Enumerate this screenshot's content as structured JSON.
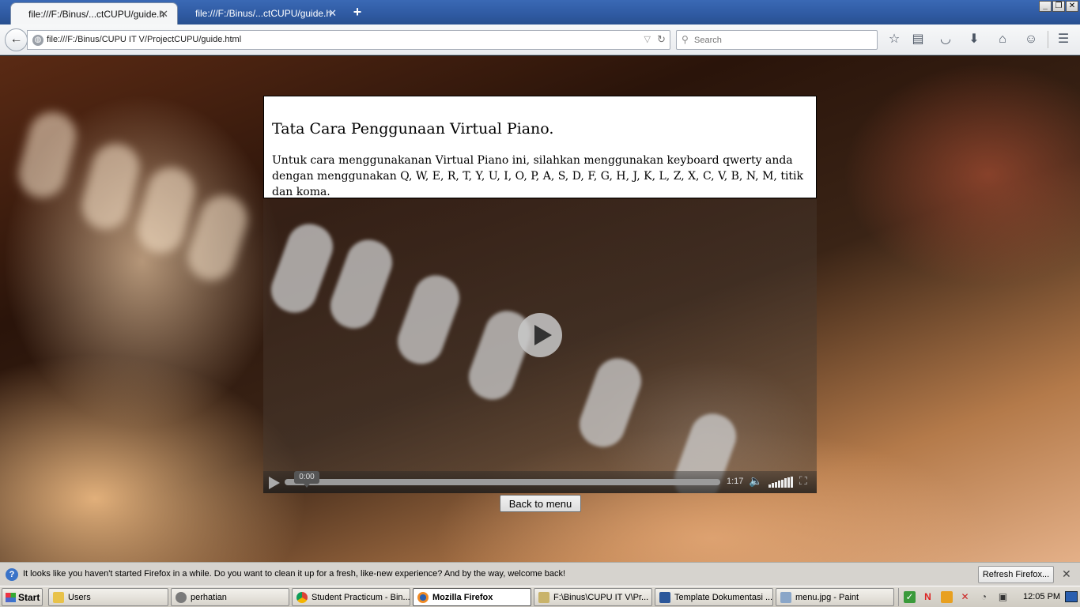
{
  "browser": {
    "tabs": [
      {
        "title": "file:///F:/Binus/...ctCUPU/guide.html",
        "active": true
      },
      {
        "title": "file:///F:/Binus/...ctCUPU/guide.html",
        "active": false
      }
    ],
    "url": "file:///F:/Binus/CUPU IT V/ProjectCUPU/guide.html",
    "search_placeholder": "Search",
    "icons": [
      "back-arrow-icon",
      "globe-icon",
      "reload-icon",
      "search-icon",
      "star-icon",
      "reading-list-icon",
      "pocket-icon",
      "download-icon",
      "home-icon",
      "hello-chat-icon",
      "menu-icon"
    ]
  },
  "page": {
    "heading": "Tata Cara Penggunaan Virtual Piano.",
    "instructions": "Untuk cara menggunakanan Virtual Piano ini, silahkan menggunakan keyboard qwerty anda dengan menggunakan Q, W, E, R, T, Y, U, I, O, P, A, S, D, F, G, H, J, K, L, Z, X, C, V, B, N, M, titik dan koma.",
    "video": {
      "current_time": "0:00",
      "duration": "1:17",
      "progress": 0
    },
    "back_button": "Back to menu"
  },
  "notification": {
    "message": "It looks like you haven't started Firefox in a while. Do you want to clean it up for a fresh, like-new experience? And by the way, welcome back!",
    "button": "Refresh Firefox..."
  },
  "taskbar": {
    "start": "Start",
    "tasks": [
      {
        "label": "Users",
        "active": false
      },
      {
        "label": "perhatian",
        "active": false
      },
      {
        "label": "Student Practicum - Bin...",
        "active": false
      },
      {
        "label": "Mozilla Firefox",
        "active": true
      },
      {
        "label": "F:\\Binus\\CUPU IT V\\Pr...",
        "active": false
      },
      {
        "label": "Template Dokumentasi ...",
        "active": false
      },
      {
        "label": "menu.jpg - Paint",
        "active": false
      }
    ],
    "clock": "12:05 PM"
  },
  "colors": {
    "titlebar": "#2f5aa2",
    "notification_bar": "#d6d3ce",
    "taskbar": "#d4d0c8"
  }
}
